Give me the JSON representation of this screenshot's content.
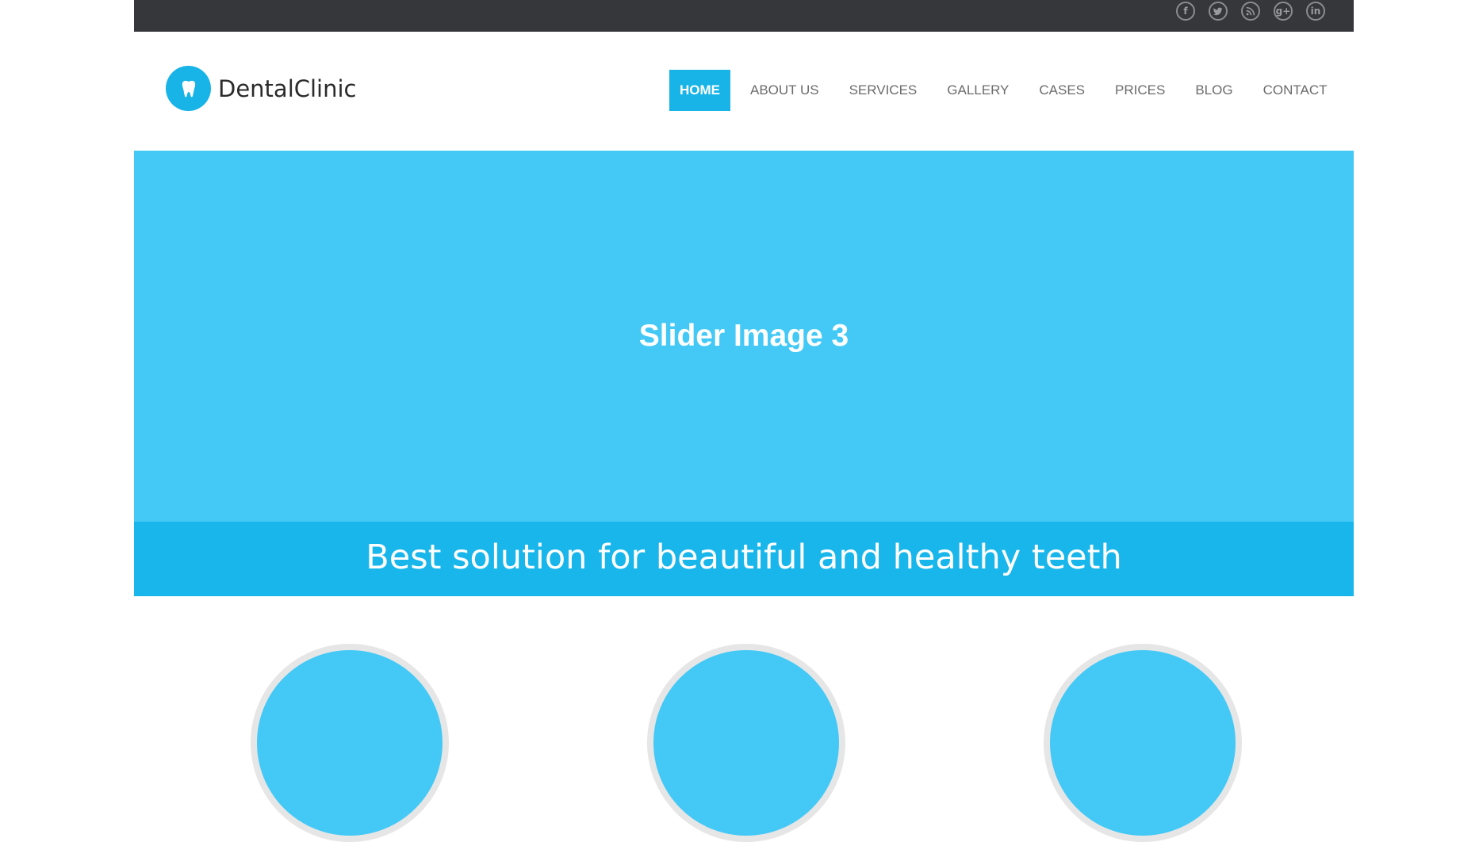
{
  "social": [
    {
      "icon": "facebook-icon",
      "glyph": "f"
    },
    {
      "icon": "twitter-icon",
      "glyph": ""
    },
    {
      "icon": "rss-icon",
      "glyph": ""
    },
    {
      "icon": "google-plus-icon",
      "glyph": "g+"
    },
    {
      "icon": "linkedin-icon",
      "glyph": "in"
    }
  ],
  "logo": {
    "text": "DentalClinic",
    "icon": "tooth-icon"
  },
  "nav": {
    "items": [
      {
        "label": "HOME",
        "active": true
      },
      {
        "label": "ABOUT US",
        "active": false
      },
      {
        "label": "SERVICES",
        "active": false
      },
      {
        "label": "GALLERY",
        "active": false
      },
      {
        "label": "CASES",
        "active": false
      },
      {
        "label": "PRICES",
        "active": false
      },
      {
        "label": "BLOG",
        "active": false
      },
      {
        "label": "CONTACT",
        "active": false
      }
    ]
  },
  "slider": {
    "image_text": "Slider Image 3",
    "caption": "Best solution for beautiful and healthy teeth"
  },
  "colors": {
    "topbar": "#36373b",
    "accent": "#18b4e7",
    "slider_bg": "#44c9f6"
  }
}
